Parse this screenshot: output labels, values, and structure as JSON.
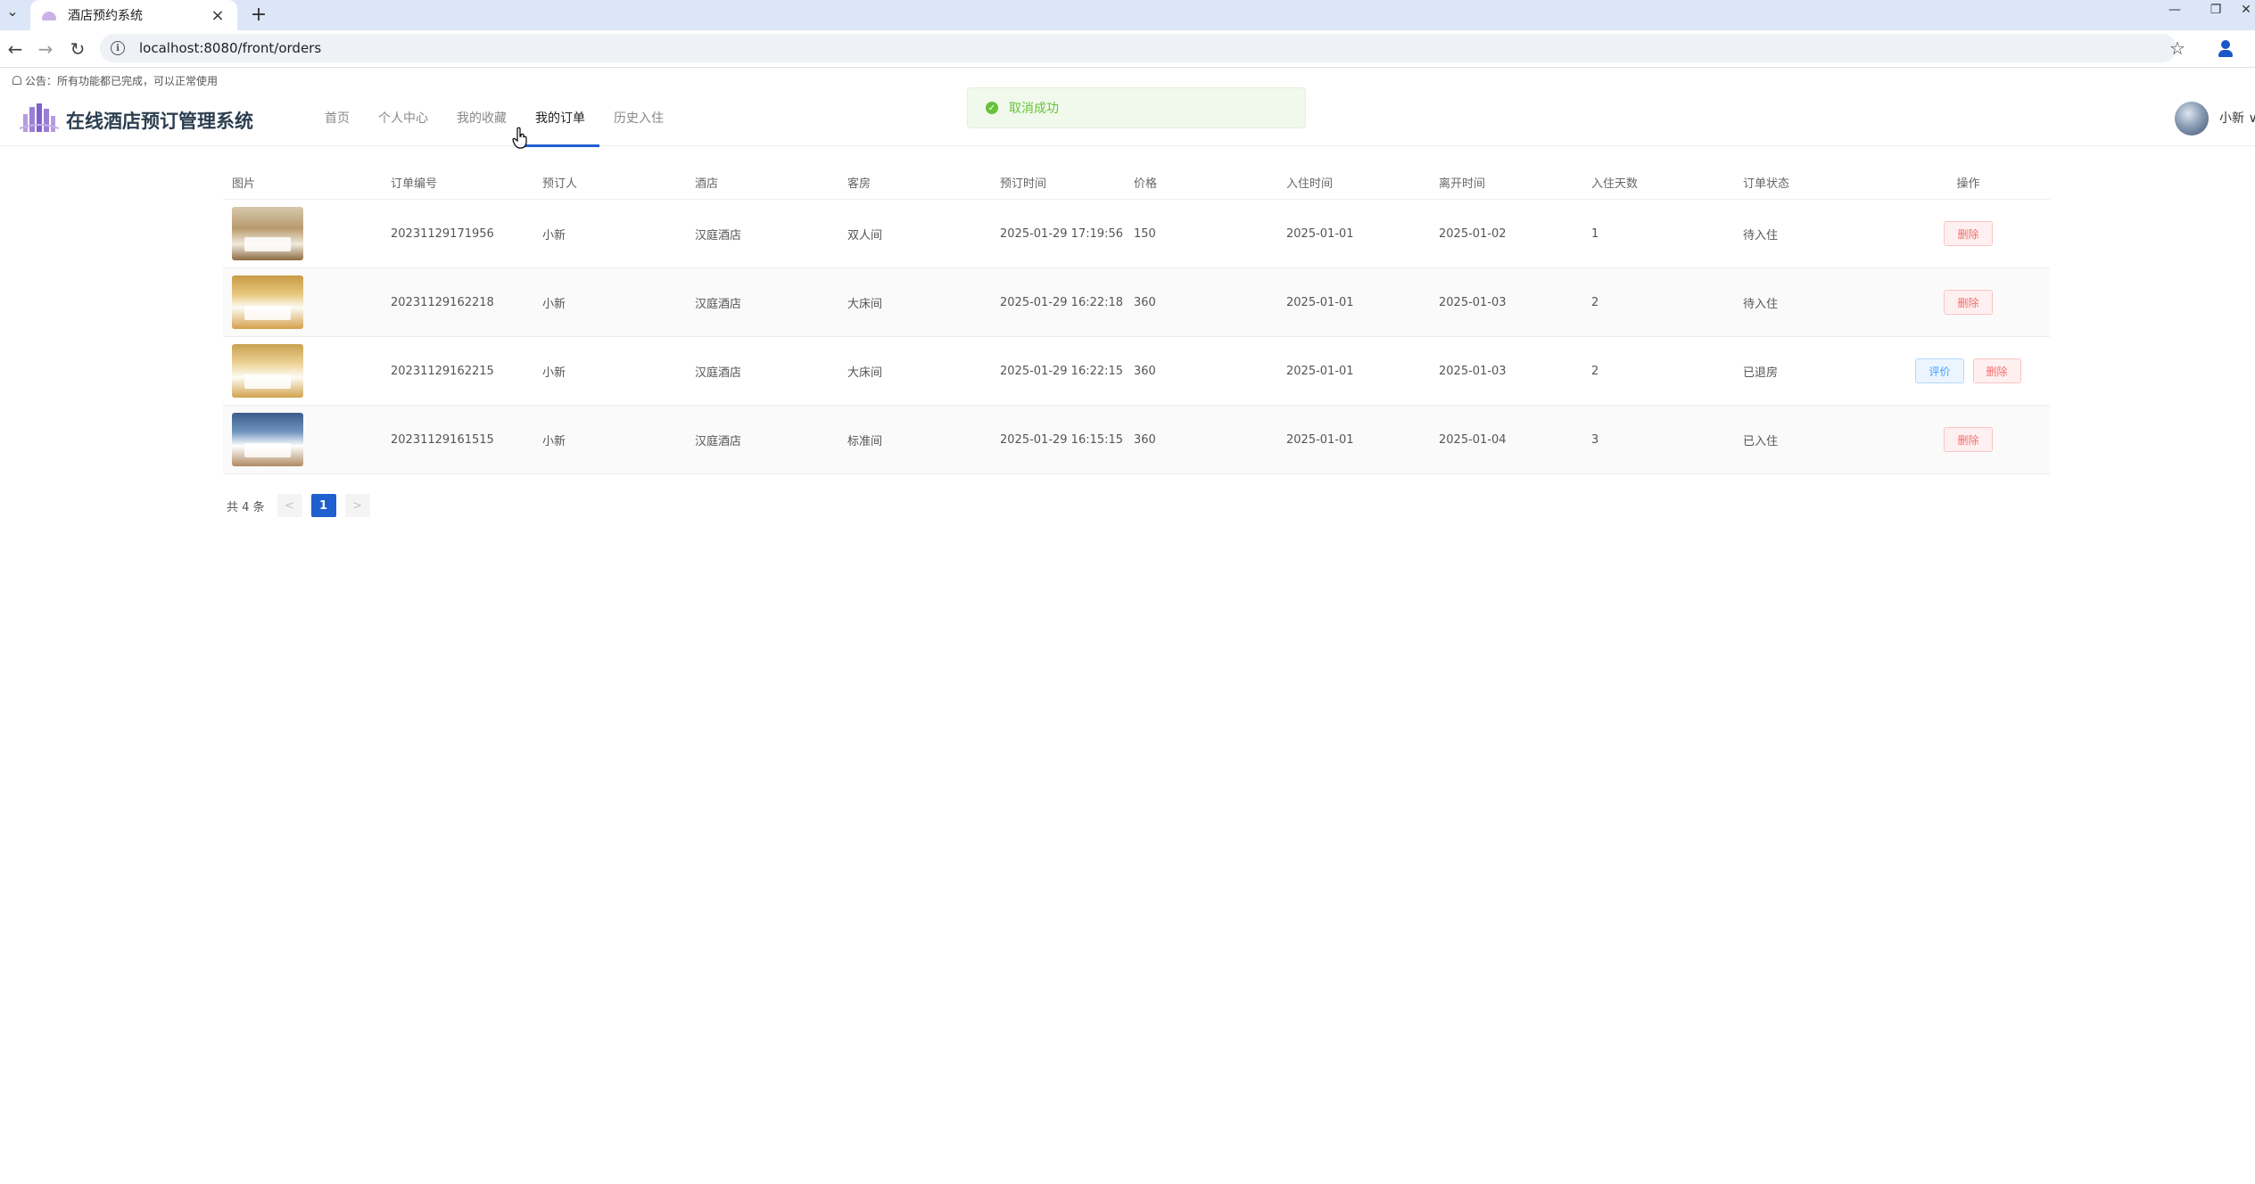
{
  "browser": {
    "tab_title": "酒店预约系统",
    "url": "localhost:8080/front/orders"
  },
  "notice": "公告：所有功能都已完成，可以正常使用",
  "site": {
    "title": "在线酒店预订管理系统",
    "nav": [
      "首页",
      "个人中心",
      "我的收藏",
      "我的订单",
      "历史入住"
    ],
    "active_nav": "我的订单",
    "user_name": "小新 ∨"
  },
  "toast": {
    "text": "取消成功",
    "type": "success",
    "color": "#67c23a"
  },
  "table": {
    "headers": [
      "图片",
      "订单编号",
      "预订人",
      "酒店",
      "客房",
      "预订时间",
      "价格",
      "入住时间",
      "离开时间",
      "入住天数",
      "订单状态",
      "操作"
    ],
    "rows": [
      {
        "order_no": "20231129171956",
        "booker": "小新",
        "hotel": "汉庭酒店",
        "room": "双人间",
        "book_time": "2025-01-29 17:19:56",
        "price": "150",
        "checkin": "2025-01-01",
        "checkout": "2025-01-02",
        "days": "1",
        "status": "待入住",
        "actions": [
          "删除"
        ]
      },
      {
        "order_no": "20231129162218",
        "booker": "小新",
        "hotel": "汉庭酒店",
        "room": "大床间",
        "book_time": "2025-01-29 16:22:18",
        "price": "360",
        "checkin": "2025-01-01",
        "checkout": "2025-01-03",
        "days": "2",
        "status": "待入住",
        "actions": [
          "删除"
        ]
      },
      {
        "order_no": "20231129162215",
        "booker": "小新",
        "hotel": "汉庭酒店",
        "room": "大床间",
        "book_time": "2025-01-29 16:22:15",
        "price": "360",
        "checkin": "2025-01-01",
        "checkout": "2025-01-03",
        "days": "2",
        "status": "已退房",
        "actions": [
          "评价",
          "删除"
        ]
      },
      {
        "order_no": "20231129161515",
        "booker": "小新",
        "hotel": "汉庭酒店",
        "room": "标准间",
        "book_time": "2025-01-29 16:15:15",
        "price": "360",
        "checkin": "2025-01-01",
        "checkout": "2025-01-04",
        "days": "3",
        "status": "已入住",
        "actions": [
          "删除"
        ]
      }
    ]
  },
  "pagination": {
    "total": "共 4 条",
    "prev": "<",
    "current": "1",
    "next": ">"
  },
  "colors": {
    "accent": "#1f5fd0",
    "danger": "#f56c6c",
    "primary": "#409eff"
  }
}
